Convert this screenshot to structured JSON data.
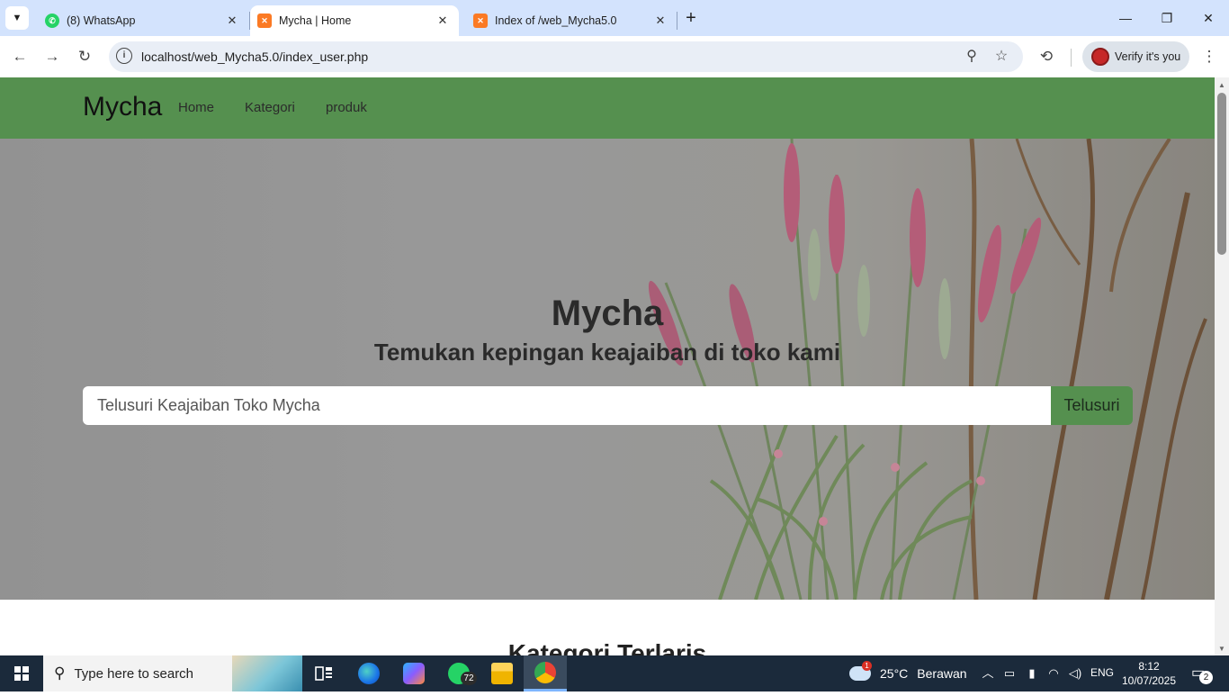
{
  "browser": {
    "tabs": [
      {
        "title": "(8) WhatsApp",
        "favicon": "whatsapp-icon",
        "active": false
      },
      {
        "title": "Mycha | Home",
        "favicon": "xampp-icon",
        "active": true
      },
      {
        "title": "Index of /web_Mycha5.0",
        "favicon": "xampp-icon",
        "active": false
      }
    ],
    "url": "localhost/web_Mycha5.0/index_user.php",
    "verify_label": "Verify it's you"
  },
  "site": {
    "brand": "Mycha",
    "nav": [
      "Home",
      "Kategori",
      "produk"
    ],
    "hero_title": "Mycha",
    "hero_subtitle": "Temukan kepingan keajaiban di toko kami",
    "search_placeholder": "Telusuri Keajaiban Toko Mycha",
    "search_button": "Telusuri",
    "section_title": "Kategori Terlaris",
    "colors": {
      "navbar": "#55904f",
      "button": "#55904f"
    }
  },
  "taskbar": {
    "search_placeholder": "Type here to search",
    "whatsapp_badge": "72",
    "weather_temp": "25°C",
    "weather_text": "Berawan",
    "weather_alert": "1",
    "language": "ENG",
    "time": "8:12",
    "date": "10/07/2025",
    "notifications": "2"
  }
}
